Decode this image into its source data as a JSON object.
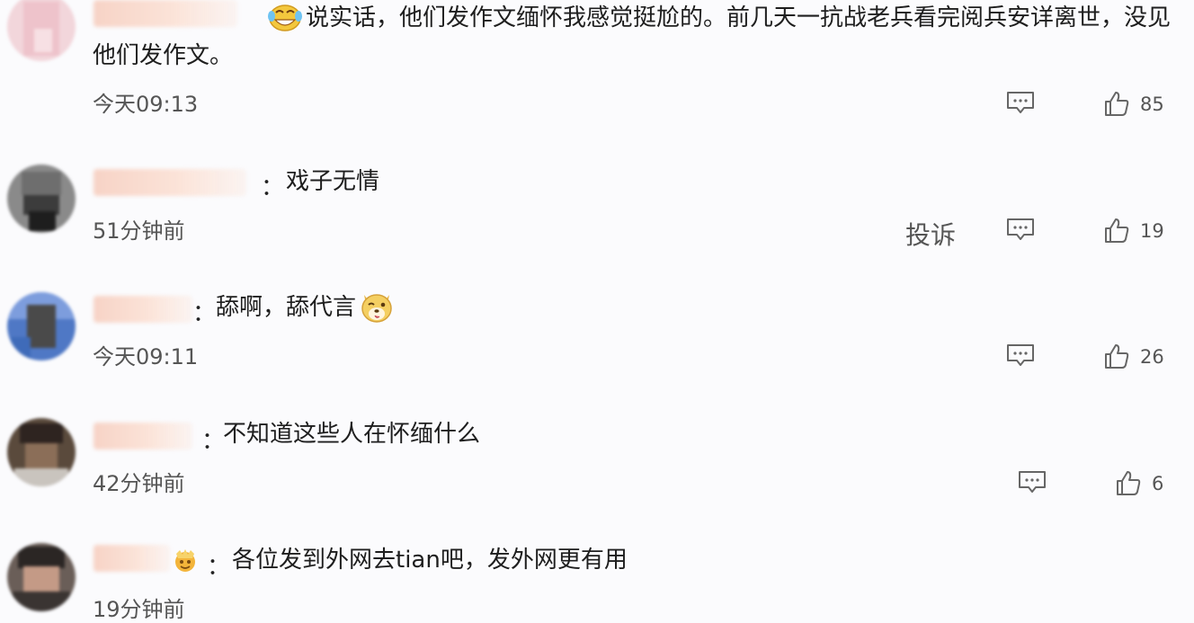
{
  "comments": [
    {
      "text_line1": "说实话，他们发作文缅怀我感觉挺尬的。前几天一抗战老兵看完阅兵安详离世，没见",
      "text_line2": "他们发作文。",
      "time": "今天09:13",
      "likes": "85",
      "emoji": "laugh-cry-emoji"
    },
    {
      "separator": "：",
      "text": "戏子无情",
      "time": "51分钟前",
      "report": "投诉",
      "likes": "19"
    },
    {
      "separator": "：",
      "text": "舔啊，舔代言",
      "time": "今天09:11",
      "likes": "26",
      "emoji": "dog-emoji"
    },
    {
      "separator": "：",
      "text": "不知道这些人在怀缅什么",
      "time": "42分钟前",
      "likes": "6"
    },
    {
      "separator": "：",
      "text": "各位发到外网去tian吧，发外网更有用",
      "time": "19分钟前",
      "badge": "badge-icon"
    }
  ],
  "colors": {
    "background": "#fbfbfd",
    "name_blur": "#f7d3c6",
    "meta_text": "#555555"
  }
}
